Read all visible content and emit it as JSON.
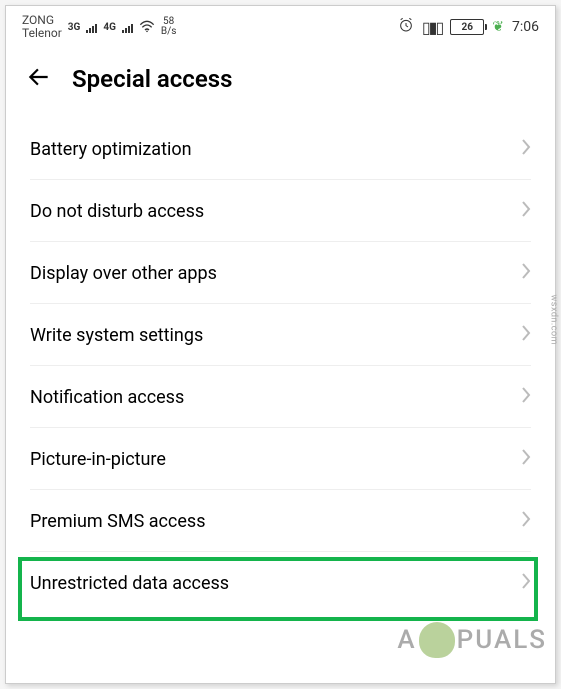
{
  "status_bar": {
    "carrier1": "ZONG",
    "carrier2": "Telenor",
    "net1": "3G",
    "net2": "4G",
    "speed_value": "58",
    "speed_unit": "B/s",
    "battery_percent": "26",
    "time": "7:06"
  },
  "header": {
    "title": "Special access"
  },
  "items": [
    {
      "label": "Battery optimization"
    },
    {
      "label": "Do not disturb access"
    },
    {
      "label": "Display over other apps"
    },
    {
      "label": "Write system settings"
    },
    {
      "label": "Notification access"
    },
    {
      "label": "Picture-in-picture"
    },
    {
      "label": "Premium SMS access"
    },
    {
      "label": "Unrestricted data access"
    }
  ],
  "watermark": {
    "part1": "A",
    "part2": "PUALS",
    "source": "wsxdn.com"
  }
}
